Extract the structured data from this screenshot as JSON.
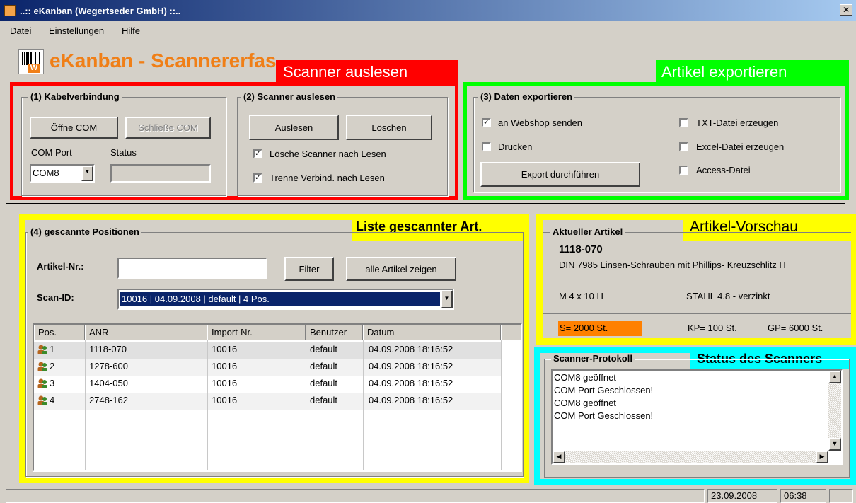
{
  "window": {
    "title": "..:: eKanban (Wegertseder GmbH) ::..",
    "close_glyph": "✕"
  },
  "menu": [
    "Datei",
    "Einstellungen",
    "Hilfe"
  ],
  "header": {
    "app_title": "eKanban - Scannererfassung"
  },
  "annotations": {
    "scanner_auslesen": "Scanner auslesen",
    "artikel_exportieren": "Artikel exportieren",
    "liste": "Liste gescannter Art.",
    "vorschau": "Artikel-Vorschau",
    "status": "Status des Scanners"
  },
  "colors": {
    "red": "#ff0000",
    "green": "#00ff00",
    "yellow": "#ffff00",
    "cyan": "#00ffff",
    "orange": "#f07f17",
    "selection": "#0a246a",
    "s_badge": "#ff8000"
  },
  "group1": {
    "title": "(1) Kabelverbindung",
    "open_button": "Öffne COM",
    "close_button": "Schließe COM",
    "port_label": "COM Port",
    "status_label": "Status",
    "port_value": "COM8",
    "status_value": ""
  },
  "group2": {
    "title": "(2) Scanner auslesen",
    "read_button": "Auslesen",
    "delete_button": "Löschen",
    "cb_delete": {
      "label": "Lösche Scanner nach Lesen",
      "checked": true
    },
    "cb_disconnect": {
      "label": "Trenne Verbind. nach Lesen",
      "checked": true
    }
  },
  "group3": {
    "title": "(3) Daten exportieren",
    "cb_webshop": {
      "label": "an Webshop senden",
      "checked": true
    },
    "cb_print": {
      "label": "Drucken",
      "checked": false
    },
    "cb_txt": {
      "label": "TXT-Datei erzeugen",
      "checked": false
    },
    "cb_excel": {
      "label": "Excel-Datei erzeugen",
      "checked": false
    },
    "cb_access": {
      "label": "Access-Datei",
      "checked": false
    },
    "export_button": "Export durchführen"
  },
  "group4": {
    "title": "(4) gescannte Positionen",
    "artikel_label": "Artikel-Nr.:",
    "artikel_value": "",
    "filter_button": "Filter",
    "show_all_button": "alle Artikel zeigen",
    "scanid_label": "Scan-ID:",
    "scanid_value": "10016  |  04.09.2008  |  default  |  4 Pos."
  },
  "table": {
    "columns": [
      "Pos.",
      "ANR",
      "Import-Nr.",
      "Benutzer",
      "Datum"
    ],
    "rows": [
      [
        "1",
        "1118-070",
        "10016",
        "default",
        "04.09.2008 18:16:52"
      ],
      [
        "2",
        "1278-600",
        "10016",
        "default",
        "04.09.2008 18:16:52"
      ],
      [
        "3",
        "1404-050",
        "10016",
        "default",
        "04.09.2008 18:16:52"
      ],
      [
        "4",
        "2748-162",
        "10016",
        "default",
        "04.09.2008 18:16:52"
      ]
    ],
    "row_icon": "user-icon"
  },
  "artikel": {
    "title": "Aktueller Artikel",
    "number": "1118-070",
    "description": "DIN 7985 Linsen-Schrauben mit Phillips- Kreuzschlitz H",
    "size": "M  4 x 10 H",
    "material": "STAHL 4.8 - verzinkt",
    "s": "S= 2000 St.",
    "kp": "KP= 100 St.",
    "gp": "GP= 6000 St."
  },
  "protokoll": {
    "title": "Scanner-Protokoll",
    "lines": [
      "COM8 geöffnet",
      "COM Port Geschlossen!",
      "COM8 geöffnet",
      "COM Port Geschlossen!"
    ]
  },
  "statusbar": {
    "date": "23.09.2008",
    "time": "06:38"
  }
}
